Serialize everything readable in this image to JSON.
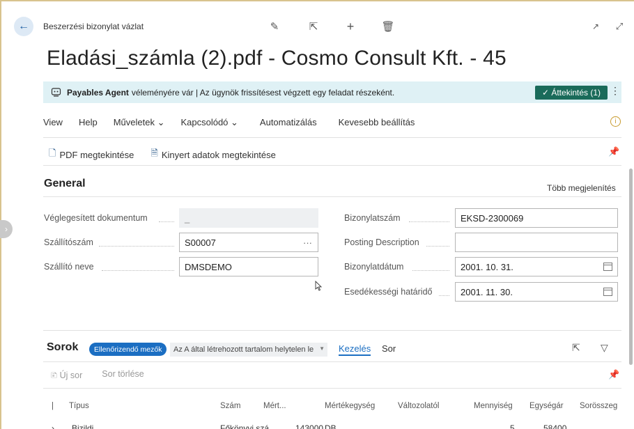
{
  "header": {
    "caption": "Beszerzési bizonylat vázlat",
    "title": "Eladási_számla (2).pdf - Cosmo Consult Kft. - 45"
  },
  "banner": {
    "agent": "Payables Agent",
    "message": "véleményére vár | Az ügynök frissítésest végzett egy feladat részeként.",
    "review_label": "✓ Áttekintés (1)"
  },
  "menu": {
    "items": [
      "View",
      "Help",
      "Műveletek ⌄",
      "Kapcsolódó ⌄",
      "Automatizálás",
      "Kevesebb beállítás"
    ]
  },
  "actions": {
    "pdf": "PDF megtekintése",
    "extracted": "Kinyert adatok megtekintése"
  },
  "general": {
    "title": "General",
    "more": "Több megjelenítés",
    "fields": {
      "posted_doc": {
        "label": "Véglegesített dokumentum",
        "value": "_"
      },
      "vendor_no": {
        "label": "Szállítószám",
        "value": "S00007"
      },
      "vendor_name": {
        "label": "Szállító neve",
        "value": "DMSDEMO"
      },
      "doc_no": {
        "label": "Bizonylatszám",
        "value": "EKSD-2300069"
      },
      "posting_desc": {
        "label": "Posting Description",
        "value": ""
      },
      "doc_date": {
        "label": "Bizonylatdátum",
        "value": "2001. 10. 31."
      },
      "due_date": {
        "label": "Esedékességi határidő",
        "value": "2001. 11. 30."
      }
    }
  },
  "lines": {
    "title": "Sorok",
    "badge": "Ellenőrizendő mezők",
    "filter": "Az A által létrehozott tartalom helytelen le",
    "tab_manage": "Kezelés",
    "tab_line": "Sor",
    "new_line": "Új sor",
    "delete_line": "Sor törlése",
    "columns": [
      "Típus",
      "Szám",
      "Mért...",
      "Mértékegység",
      "Változolatól",
      "Mennyiség",
      "Egységár",
      "Sorösszeg"
    ],
    "row_partial": {
      "type": "Bizildi",
      "no": "Főkönyvi szá...",
      "unit": "143000",
      "uom": "DB",
      "qty": "5",
      "price": "58400"
    }
  }
}
